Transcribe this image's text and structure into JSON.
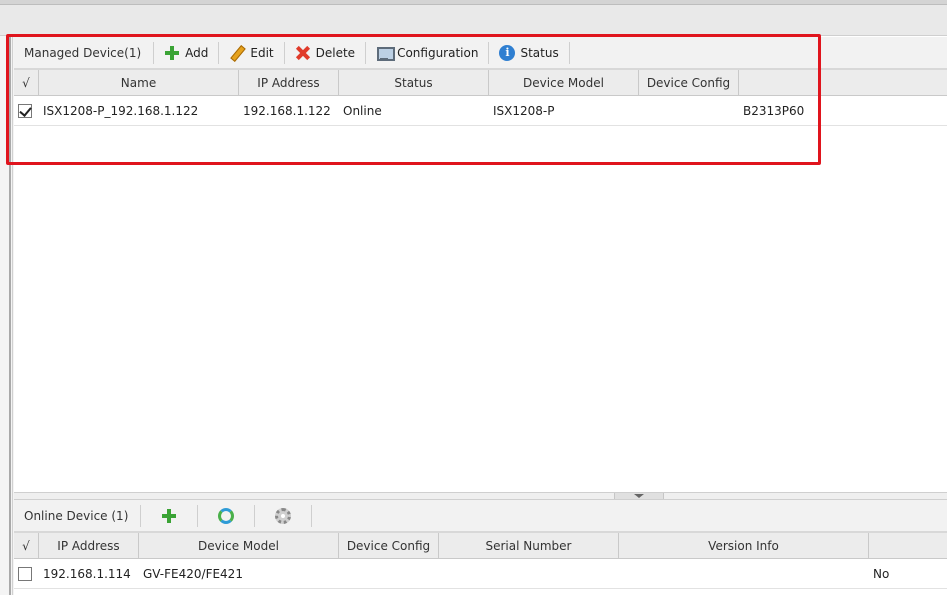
{
  "managed": {
    "title": "Managed Device(1)",
    "buttons": {
      "add": "Add",
      "edit": "Edit",
      "delete": "Delete",
      "configuration": "Configuration",
      "status": "Status"
    },
    "columns": [
      "√",
      "Name",
      "IP Address",
      "Status",
      "Device Model",
      "Device Config"
    ],
    "rows": [
      {
        "checked": true,
        "name": "ISX1208-P_192.168.1.122",
        "ip": "192.168.1.122",
        "status": "Online",
        "model": "ISX1208-P",
        "config": "",
        "extra": "B2313P60"
      }
    ]
  },
  "online": {
    "title": "Online Device (1)",
    "columns": [
      "√",
      "IP Address",
      "Device Model",
      "Device Config",
      "Serial Number",
      "Version Info"
    ],
    "rows": [
      {
        "checked": false,
        "ip": "192.168.1.114",
        "model": "GV-FE420/FE421",
        "config": "",
        "serial": "",
        "version": "",
        "extra": "No"
      }
    ]
  },
  "icons": {
    "add": "plus-icon",
    "edit": "pencil-icon",
    "delete": "delete-x-icon",
    "configuration": "monitor-icon",
    "status": "info-icon",
    "refresh": "refresh-icon",
    "settings": "gear-icon"
  },
  "colors": {
    "highlight": "#e0141d",
    "add_green": "#3aa335",
    "delete_red": "#e03a2a",
    "info_blue": "#2f7fd1"
  }
}
